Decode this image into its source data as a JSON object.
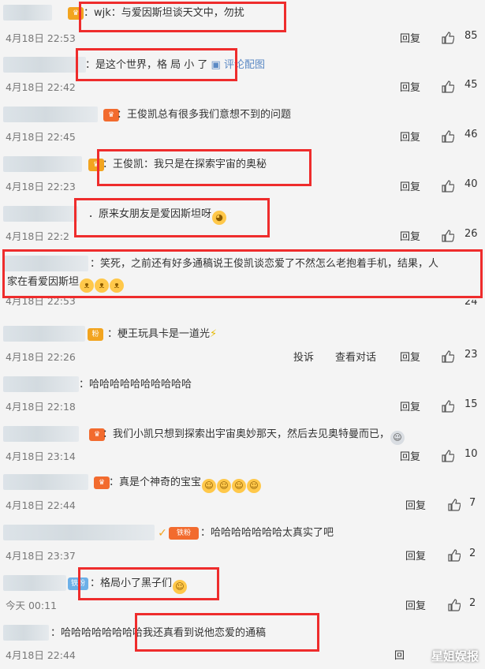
{
  "comments": [
    {
      "text": "：wjk：与爱因斯坦谈天文中，勿扰",
      "time": "4月18日 22:53",
      "reply": "回复",
      "likes": "85"
    },
    {
      "text": "：是这个世界，格 局 小 了",
      "extra_link": "评论配图",
      "time": "4月18日 22:42",
      "reply": "回复",
      "likes": "45"
    },
    {
      "text": "：王俊凯总有很多我们意想不到的问题",
      "time": "4月18日 22:45",
      "reply": "回复",
      "likes": "46"
    },
    {
      "text": "：王俊凯：我只是在探索宇宙的奥秘",
      "time": "4月18日 22:23",
      "reply": "回复",
      "likes": "40"
    },
    {
      "text": "．原来女朋友是爱因斯坦呀",
      "time": "4月18日 22:2",
      "reply": "回复",
      "likes": "26"
    },
    {
      "text": "：笑死，之前还有好多通稿说王俊凯谈恋爱了不然怎么老抱着手机，结果，人",
      "text2": "家在看爱因斯坦",
      "time": "4月18日 22:53",
      "reply": "回复",
      "likes": "24"
    },
    {
      "text": "：梗王玩具卡是一道光",
      "time": "4月18日 22:26",
      "report": "投诉",
      "view_dialog": "查看对话",
      "reply": "回复",
      "likes": "23"
    },
    {
      "text": "：哈哈哈哈哈哈哈哈哈哈",
      "time": "4月18日 22:18",
      "reply": "回复",
      "likes": "15"
    },
    {
      "text": "：我们小凯只想到探索出宇宙奥妙那天，然后去见奥特曼而已，",
      "time": "4月18日 23:14",
      "reply": "回复",
      "likes": "10"
    },
    {
      "text": "：真是个神奇的宝宝",
      "time": "4月18日 22:44",
      "reply": "回复",
      "likes": "7"
    },
    {
      "text": "：哈哈哈哈哈哈哈太真实了吧",
      "time": "4月18日 23:37",
      "reply": "回复",
      "likes": "2"
    },
    {
      "text": "：格局小了黑子们",
      "time": "今天 00:11",
      "reply": "回复",
      "likes": "2"
    },
    {
      "text": "：哈哈哈哈哈哈哈哈我还真看到说他恋爱的通稿",
      "time": "4月18日 22:44",
      "reply": "回"
    }
  ],
  "badges": {
    "fan": "粉",
    "iron_fan": "铁粉",
    "ice_fan": "铁粉"
  },
  "watermark": "星姐娱报",
  "colors": {
    "highlight_box": "#ee2c2c",
    "link": "#5b89c4",
    "badge": "#f2a41f"
  }
}
